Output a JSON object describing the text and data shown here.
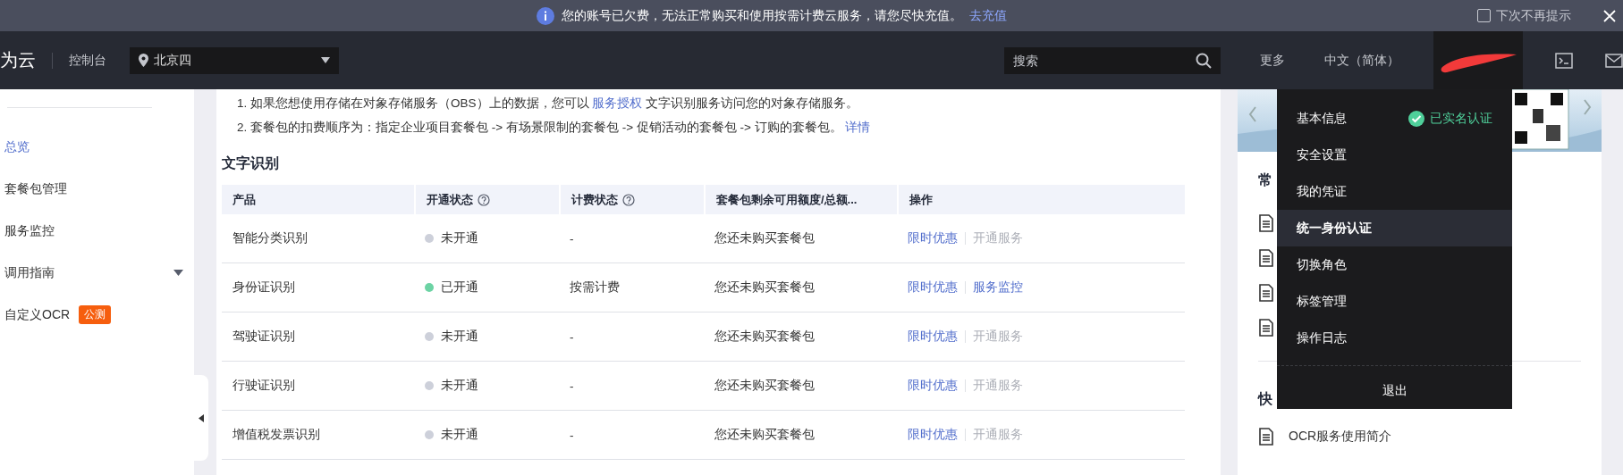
{
  "notice": {
    "text": "您的账号已欠费，无法正常购买和使用按需计费云服务，请您尽快充值。",
    "link": "去充值",
    "dont_show": {
      "label": "下次不再提示",
      "checked": false
    }
  },
  "header": {
    "logo": "为云",
    "console": "控制台",
    "region": "北京四",
    "search": {
      "placeholder": "搜索"
    },
    "more": "更多",
    "language": "中文（简体）"
  },
  "sidebar": {
    "items": [
      {
        "label": "总览",
        "selected": true
      },
      {
        "label": "套餐包管理",
        "selected": false
      },
      {
        "label": "服务监控",
        "selected": false
      },
      {
        "label": "调用指南",
        "selected": false,
        "expanded": false
      },
      {
        "label": "自定义OCR",
        "selected": false,
        "badge": "公测"
      }
    ]
  },
  "notes": [
    {
      "before": "1. 如果您想使用存储在对象存储服务（OBS）上的数据，您可以 ",
      "link": "服务授权",
      "after": " 文字识别服务访问您的对象存储服务。"
    },
    {
      "before": "2. 套餐包的扣费顺序为：指定企业项目套餐包 -> 有场景限制的套餐包 -> 促销活动的套餐包 -> 订购的套餐包。 ",
      "link": "详情"
    }
  ],
  "section_title": "文字识别",
  "table": {
    "columns": [
      {
        "label": "产品",
        "help": false
      },
      {
        "label": "开通状态",
        "help": true
      },
      {
        "label": "计费状态",
        "help": true
      },
      {
        "label": "套餐包剩余可用额度/总额...",
        "help": false
      },
      {
        "label": "操作",
        "help": false
      }
    ],
    "rows": [
      {
        "product": "智能分类识别",
        "status": "未开通",
        "enabled": false,
        "billing": "-",
        "quota": "您还未购买套餐包",
        "actions": [
          {
            "label": "限时优惠",
            "disabled": false
          },
          {
            "label": "开通服务",
            "disabled": true
          }
        ]
      },
      {
        "product": "身份证识别",
        "status": "已开通",
        "enabled": true,
        "billing": "按需计费",
        "quota": "您还未购买套餐包",
        "actions": [
          {
            "label": "限时优惠",
            "disabled": false
          },
          {
            "label": "服务监控",
            "disabled": false
          }
        ]
      },
      {
        "product": "驾驶证识别",
        "status": "未开通",
        "enabled": false,
        "billing": "-",
        "quota": "您还未购买套餐包",
        "actions": [
          {
            "label": "限时优惠",
            "disabled": false
          },
          {
            "label": "开通服务",
            "disabled": true
          }
        ]
      },
      {
        "product": "行驶证识别",
        "status": "未开通",
        "enabled": false,
        "billing": "-",
        "quota": "您还未购买套餐包",
        "actions": [
          {
            "label": "限时优惠",
            "disabled": false
          },
          {
            "label": "开通服务",
            "disabled": true
          }
        ]
      },
      {
        "product": "增值税发票识别",
        "status": "未开通",
        "enabled": false,
        "billing": "-",
        "quota": "您还未购买套餐包",
        "actions": [
          {
            "label": "限时优惠",
            "disabled": false
          },
          {
            "label": "开通服务",
            "disabled": true
          }
        ]
      }
    ]
  },
  "right_panel": {
    "heading_1": "常",
    "heading_2": "快",
    "links": [
      "OCR服务使用简介"
    ]
  },
  "user_menu": {
    "items": [
      {
        "label": "基本信息",
        "selected": false,
        "verified": "已实名认证"
      },
      {
        "label": "安全设置",
        "selected": false
      },
      {
        "label": "我的凭证",
        "selected": false
      },
      {
        "label": "统一身份认证",
        "selected": true
      },
      {
        "label": "切换角色",
        "selected": false
      },
      {
        "label": "标签管理",
        "selected": false
      },
      {
        "label": "操作日志",
        "selected": false
      }
    ],
    "logout": "退出"
  }
}
